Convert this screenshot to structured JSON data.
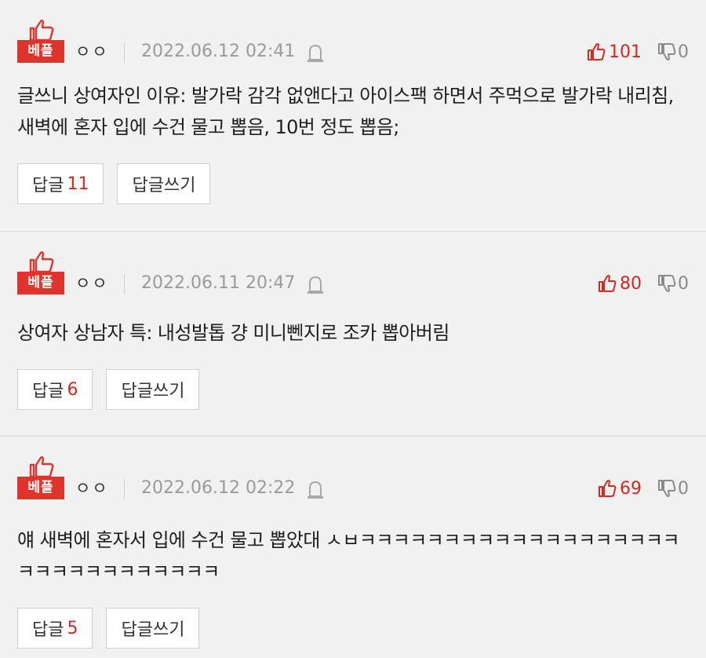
{
  "badge_label": "베플",
  "reply_label": "답글",
  "write_reply_label": "답글쓰기",
  "colors": {
    "accent": "#e0332c",
    "background": "#f1f1f1"
  },
  "comments": [
    {
      "nickname": "ㅇㅇ",
      "datetime": "2022.06.12 02:41",
      "upvotes": "101",
      "downvotes": "0",
      "text": "글쓰니 상여자인 이유: 발가락 감각 없앤다고 아이스팩 하면서 주먹으로 발가락 내리침, 새벽에 혼자 입에 수건 물고 뽑음, 10번 정도 뽑음;",
      "reply_count": "11"
    },
    {
      "nickname": "ㅇㅇ",
      "datetime": "2022.06.11 20:47",
      "upvotes": "80",
      "downvotes": "0",
      "text": "상여자 상남자 특: 내성발톱 걍 미니뻰지로 조카 뽑아버림",
      "reply_count": "6"
    },
    {
      "nickname": "ㅇㅇ",
      "datetime": "2022.06.12 02:22",
      "upvotes": "69",
      "downvotes": "0",
      "text": "얘 새벽에 혼자서 입에 수건 물고 뽑았대 ㅅㅂㅋㅋㅋㅋㅋㅋㅋㅋㅋㅋㅋㅋㅋㅋㅋㅋㅋㅋㅋㅋㅋㅋㅋㅋㅋㅋㅋㅋㅋㅋㅋ",
      "reply_count": "5"
    }
  ]
}
